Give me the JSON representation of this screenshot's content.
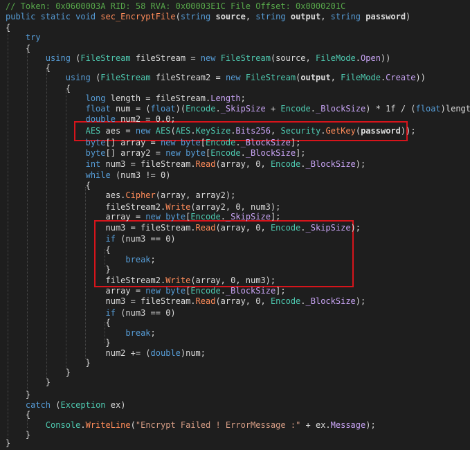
{
  "editor": {
    "lines": [
      [
        [
          "c-comment",
          "// Token: 0x0600003A RID: 58 RVA: 0x00003E1C File Offset: 0x0000201C"
        ]
      ],
      [
        [
          "c-kw",
          "public static void "
        ],
        [
          "c-method",
          "sec_EncryptFile"
        ],
        [
          "c-plain",
          "("
        ],
        [
          "c-kw",
          "string "
        ],
        [
          "c-bold",
          "source"
        ],
        [
          "c-plain",
          ", "
        ],
        [
          "c-kw",
          "string "
        ],
        [
          "c-bold",
          "output"
        ],
        [
          "c-plain",
          ", "
        ],
        [
          "c-kw",
          "string "
        ],
        [
          "c-bold",
          "password"
        ],
        [
          "c-plain",
          ")"
        ]
      ],
      [
        [
          "c-plain",
          "{"
        ]
      ],
      [
        [
          "c-plain",
          "    "
        ],
        [
          "c-kw",
          "try"
        ]
      ],
      [
        [
          "c-plain",
          "    {"
        ]
      ],
      [
        [
          "c-plain",
          "        "
        ],
        [
          "c-kw",
          "using "
        ],
        [
          "c-plain",
          "("
        ],
        [
          "c-type",
          "FileStream "
        ],
        [
          "c-plain",
          "fileStream = "
        ],
        [
          "c-kw",
          "new "
        ],
        [
          "c-type",
          "FileStream"
        ],
        [
          "c-plain",
          "(source, "
        ],
        [
          "c-type",
          "FileMode"
        ],
        [
          "c-plain",
          "."
        ],
        [
          "c-prop",
          "Open"
        ],
        [
          "c-plain",
          "))"
        ]
      ],
      [
        [
          "c-plain",
          "        {"
        ]
      ],
      [
        [
          "c-plain",
          "            "
        ],
        [
          "c-kw",
          "using "
        ],
        [
          "c-plain",
          "("
        ],
        [
          "c-type",
          "FileStream "
        ],
        [
          "c-plain",
          "fileStream2 = "
        ],
        [
          "c-kw",
          "new "
        ],
        [
          "c-type",
          "FileStream"
        ],
        [
          "c-plain",
          "("
        ],
        [
          "c-bold",
          "output"
        ],
        [
          "c-plain",
          ", "
        ],
        [
          "c-type",
          "FileMode"
        ],
        [
          "c-plain",
          "."
        ],
        [
          "c-prop",
          "Create"
        ],
        [
          "c-plain",
          "))"
        ]
      ],
      [
        [
          "c-plain",
          "            {"
        ]
      ],
      [
        [
          "c-plain",
          "                "
        ],
        [
          "c-kw",
          "long "
        ],
        [
          "c-plain",
          "length = fileStream."
        ],
        [
          "c-prop",
          "Length"
        ],
        [
          "c-plain",
          ";"
        ]
      ],
      [
        [
          "c-plain",
          "                "
        ],
        [
          "c-kw",
          "float "
        ],
        [
          "c-plain",
          "num = ("
        ],
        [
          "c-kw",
          "float"
        ],
        [
          "c-plain",
          ")("
        ],
        [
          "c-type",
          "Encode"
        ],
        [
          "c-plain",
          "."
        ],
        [
          "c-prop",
          "_SkipSize"
        ],
        [
          "c-plain",
          " + "
        ],
        [
          "c-type",
          "Encode"
        ],
        [
          "c-plain",
          "."
        ],
        [
          "c-prop",
          "_BlockSize"
        ],
        [
          "c-plain",
          ") * 1f / ("
        ],
        [
          "c-kw",
          "float"
        ],
        [
          "c-plain",
          ")length;"
        ]
      ],
      [
        [
          "c-plain",
          "                "
        ],
        [
          "c-kw",
          "double "
        ],
        [
          "c-plain",
          "num2 = 0.0;"
        ]
      ],
      [
        [
          "c-plain",
          "                "
        ],
        [
          "c-type",
          "AES "
        ],
        [
          "c-plain",
          "aes = "
        ],
        [
          "c-kw",
          "new "
        ],
        [
          "c-type",
          "AES"
        ],
        [
          "c-plain",
          "("
        ],
        [
          "c-type",
          "AES"
        ],
        [
          "c-plain",
          "."
        ],
        [
          "c-type",
          "KeySize"
        ],
        [
          "c-plain",
          "."
        ],
        [
          "c-prop",
          "Bits256"
        ],
        [
          "c-plain",
          ", "
        ],
        [
          "c-type",
          "Security"
        ],
        [
          "c-plain",
          "."
        ],
        [
          "c-method",
          "GetKey"
        ],
        [
          "c-plain",
          "("
        ],
        [
          "c-bold",
          "password"
        ],
        [
          "c-plain",
          "));"
        ]
      ],
      [
        [
          "c-plain",
          "                "
        ],
        [
          "c-kw",
          "byte"
        ],
        [
          "c-plain",
          "[] array = "
        ],
        [
          "c-kw",
          "new byte"
        ],
        [
          "c-plain",
          "["
        ],
        [
          "c-type",
          "Encode"
        ],
        [
          "c-plain",
          "."
        ],
        [
          "c-prop",
          "_BlockSize"
        ],
        [
          "c-plain",
          "];"
        ]
      ],
      [
        [
          "c-plain",
          "                "
        ],
        [
          "c-kw",
          "byte"
        ],
        [
          "c-plain",
          "[] array2 = "
        ],
        [
          "c-kw",
          "new byte"
        ],
        [
          "c-plain",
          "["
        ],
        [
          "c-type",
          "Encode"
        ],
        [
          "c-plain",
          "."
        ],
        [
          "c-prop",
          "_BlockSize"
        ],
        [
          "c-plain",
          "];"
        ]
      ],
      [
        [
          "c-plain",
          "                "
        ],
        [
          "c-kw",
          "int "
        ],
        [
          "c-plain",
          "num3 = fileStream."
        ],
        [
          "c-method",
          "Read"
        ],
        [
          "c-plain",
          "(array, 0, "
        ],
        [
          "c-type",
          "Encode"
        ],
        [
          "c-plain",
          "."
        ],
        [
          "c-prop",
          "_BlockSize"
        ],
        [
          "c-plain",
          ");"
        ]
      ],
      [
        [
          "c-plain",
          "                "
        ],
        [
          "c-kw",
          "while "
        ],
        [
          "c-plain",
          "(num3 != 0)"
        ]
      ],
      [
        [
          "c-plain",
          "                {"
        ]
      ],
      [
        [
          "c-plain",
          "                    aes."
        ],
        [
          "c-method",
          "Cipher"
        ],
        [
          "c-plain",
          "(array, array2);"
        ]
      ],
      [
        [
          "c-plain",
          "                    fileStream2."
        ],
        [
          "c-method",
          "Write"
        ],
        [
          "c-plain",
          "(array2, 0, num3);"
        ]
      ],
      [
        [
          "c-plain",
          "                    array = "
        ],
        [
          "c-kw",
          "new byte"
        ],
        [
          "c-plain",
          "["
        ],
        [
          "c-type",
          "Encode"
        ],
        [
          "c-plain",
          "."
        ],
        [
          "c-prop",
          "_SkipSize"
        ],
        [
          "c-plain",
          "];"
        ]
      ],
      [
        [
          "c-plain",
          "                    num3 = fileStream."
        ],
        [
          "c-method",
          "Read"
        ],
        [
          "c-plain",
          "(array, 0, "
        ],
        [
          "c-type",
          "Encode"
        ],
        [
          "c-plain",
          "."
        ],
        [
          "c-prop",
          "_SkipSize"
        ],
        [
          "c-plain",
          ");"
        ]
      ],
      [
        [
          "c-plain",
          "                    "
        ],
        [
          "c-kw",
          "if "
        ],
        [
          "c-plain",
          "(num3 == 0)"
        ]
      ],
      [
        [
          "c-plain",
          "                    {"
        ]
      ],
      [
        [
          "c-plain",
          "                        "
        ],
        [
          "c-kw",
          "break"
        ],
        [
          "c-plain",
          ";"
        ]
      ],
      [
        [
          "c-plain",
          "                    }"
        ]
      ],
      [
        [
          "c-plain",
          "                    fileStream2."
        ],
        [
          "c-method",
          "Write"
        ],
        [
          "c-plain",
          "(array, 0, num3);"
        ]
      ],
      [
        [
          "c-plain",
          "                    array = "
        ],
        [
          "c-kw",
          "new byte"
        ],
        [
          "c-plain",
          "["
        ],
        [
          "c-type",
          "Encode"
        ],
        [
          "c-plain",
          "."
        ],
        [
          "c-prop",
          "_BlockSize"
        ],
        [
          "c-plain",
          "];"
        ]
      ],
      [
        [
          "c-plain",
          "                    num3 = fileStream."
        ],
        [
          "c-method",
          "Read"
        ],
        [
          "c-plain",
          "(array, 0, "
        ],
        [
          "c-type",
          "Encode"
        ],
        [
          "c-plain",
          "."
        ],
        [
          "c-prop",
          "_BlockSize"
        ],
        [
          "c-plain",
          ");"
        ]
      ],
      [
        [
          "c-plain",
          "                    "
        ],
        [
          "c-kw",
          "if "
        ],
        [
          "c-plain",
          "(num3 == 0)"
        ]
      ],
      [
        [
          "c-plain",
          "                    {"
        ]
      ],
      [
        [
          "c-plain",
          "                        "
        ],
        [
          "c-kw",
          "break"
        ],
        [
          "c-plain",
          ";"
        ]
      ],
      [
        [
          "c-plain",
          "                    }"
        ]
      ],
      [
        [
          "c-plain",
          "                    num2 += ("
        ],
        [
          "c-kw",
          "double"
        ],
        [
          "c-plain",
          ")num;"
        ]
      ],
      [
        [
          "c-plain",
          "                }"
        ]
      ],
      [
        [
          "c-plain",
          "            }"
        ]
      ],
      [
        [
          "c-plain",
          "        }"
        ]
      ],
      [
        [
          "c-plain",
          "    }"
        ]
      ],
      [
        [
          "c-plain",
          "    "
        ],
        [
          "c-kw",
          "catch "
        ],
        [
          "c-plain",
          "("
        ],
        [
          "c-type",
          "Exception "
        ],
        [
          "c-plain",
          "ex)"
        ]
      ],
      [
        [
          "c-plain",
          "    {"
        ]
      ],
      [
        [
          "c-plain",
          "        "
        ],
        [
          "c-type",
          "Console"
        ],
        [
          "c-plain",
          "."
        ],
        [
          "c-method",
          "WriteLine"
        ],
        [
          "c-plain",
          "("
        ],
        [
          "c-str",
          "\"Encrypt Failed ! ErrorMessage :\""
        ],
        [
          "c-plain",
          " + ex."
        ],
        [
          "c-prop",
          "Message"
        ],
        [
          "c-plain",
          ");"
        ]
      ],
      [
        [
          "c-plain",
          "    }"
        ]
      ],
      [
        [
          "c-plain",
          "}"
        ]
      ]
    ]
  },
  "colors": {
    "background": "#1e1e1e",
    "highlight_box": "#d7141b",
    "keyword": "#569cd6",
    "type": "#4ec9b0",
    "comment": "#57a64a",
    "string": "#d69d85"
  }
}
